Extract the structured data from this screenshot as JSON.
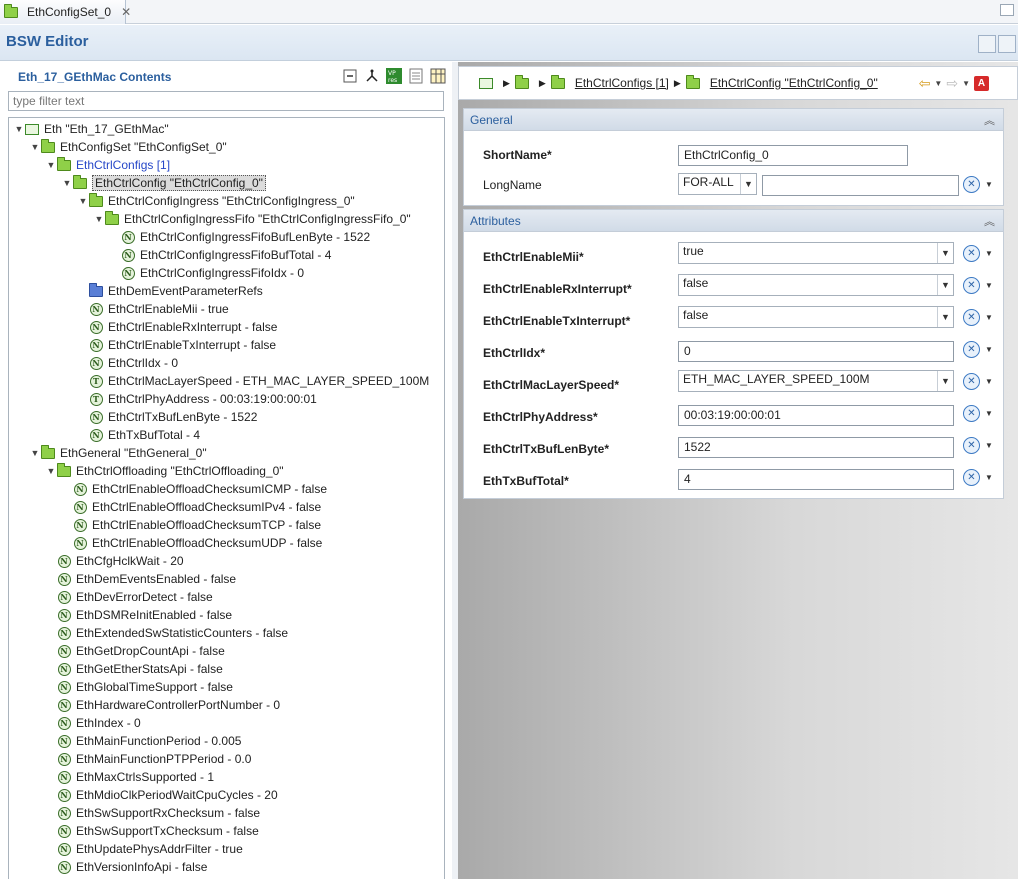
{
  "tab": {
    "label": "EthConfigSet_0",
    "close": "✕"
  },
  "editor": {
    "title": "BSW Editor"
  },
  "left": {
    "title": "Eth_17_GEthMac Contents",
    "filter_placeholder": "type filter text",
    "toolbar": [
      "collapse-all-icon",
      "hierarchy-icon",
      "vp-res-icon",
      "document-icon",
      "table-icon"
    ],
    "tree": [
      {
        "text": "Eth \"Eth_17_GEthMac\"",
        "icon": "module",
        "level": 0,
        "expanded": true
      },
      {
        "text": "EthConfigSet \"EthConfigSet_0\"",
        "icon": "folder",
        "level": 1,
        "expanded": true
      },
      {
        "text": "EthCtrlConfigs [1]",
        "icon": "folder",
        "level": 2,
        "expanded": true,
        "link": true
      },
      {
        "text": "EthCtrlConfig \"EthCtrlConfig_0\"",
        "icon": "folder",
        "level": 3,
        "expanded": true,
        "selected": true
      },
      {
        "text": "EthCtrlConfigIngress \"EthCtrlConfigIngress_0\"",
        "icon": "folder",
        "level": 4,
        "expanded": true
      },
      {
        "text": "EthCtrlConfigIngressFifo \"EthCtrlConfigIngressFifo_0\"",
        "icon": "folder",
        "level": 5,
        "expanded": true
      },
      {
        "text": "EthCtrlConfigIngressFifoBufLenByte - 1522",
        "icon": "N",
        "level": 6
      },
      {
        "text": "EthCtrlConfigIngressFifoBufTotal - 4",
        "icon": "N",
        "level": 6
      },
      {
        "text": "EthCtrlConfigIngressFifoIdx - 0",
        "icon": "N",
        "level": 6
      },
      {
        "text": "EthDemEventParameterRefs",
        "icon": "folder-blue",
        "level": 4
      },
      {
        "text": "EthCtrlEnableMii - true",
        "icon": "N",
        "level": 4
      },
      {
        "text": "EthCtrlEnableRxInterrupt - false",
        "icon": "N",
        "level": 4
      },
      {
        "text": "EthCtrlEnableTxInterrupt - false",
        "icon": "N",
        "level": 4
      },
      {
        "text": "EthCtrlIdx - 0",
        "icon": "N",
        "level": 4
      },
      {
        "text": "EthCtrlMacLayerSpeed - ETH_MAC_LAYER_SPEED_100M",
        "icon": "T",
        "level": 4
      },
      {
        "text": "EthCtrlPhyAddress - 00:03:19:00:00:01",
        "icon": "T",
        "level": 4
      },
      {
        "text": "EthCtrlTxBufLenByte - 1522",
        "icon": "N",
        "level": 4
      },
      {
        "text": "EthTxBufTotal - 4",
        "icon": "N",
        "level": 4
      },
      {
        "text": "EthGeneral \"EthGeneral_0\"",
        "icon": "folder",
        "level": 1,
        "expanded": true
      },
      {
        "text": "EthCtrlOffloading \"EthCtrlOffloading_0\"",
        "icon": "folder",
        "level": 2,
        "expanded": true
      },
      {
        "text": "EthCtrlEnableOffloadChecksumICMP - false",
        "icon": "N",
        "level": 3
      },
      {
        "text": "EthCtrlEnableOffloadChecksumIPv4 - false",
        "icon": "N",
        "level": 3
      },
      {
        "text": "EthCtrlEnableOffloadChecksumTCP - false",
        "icon": "N",
        "level": 3
      },
      {
        "text": "EthCtrlEnableOffloadChecksumUDP - false",
        "icon": "N",
        "level": 3
      },
      {
        "text": "EthCfgHclkWait - 20",
        "icon": "N",
        "level": 2
      },
      {
        "text": "EthDemEventsEnabled - false",
        "icon": "N",
        "level": 2
      },
      {
        "text": "EthDevErrorDetect - false",
        "icon": "N",
        "level": 2
      },
      {
        "text": "EthDSMReInitEnabled - false",
        "icon": "N",
        "level": 2
      },
      {
        "text": "EthExtendedSwStatisticCounters - false",
        "icon": "N",
        "level": 2
      },
      {
        "text": "EthGetDropCountApi - false",
        "icon": "N",
        "level": 2
      },
      {
        "text": "EthGetEtherStatsApi - false",
        "icon": "N",
        "level": 2
      },
      {
        "text": "EthGlobalTimeSupport - false",
        "icon": "N",
        "level": 2
      },
      {
        "text": "EthHardwareControllerPortNumber - 0",
        "icon": "N",
        "level": 2
      },
      {
        "text": "EthIndex - 0",
        "icon": "N",
        "level": 2
      },
      {
        "text": "EthMainFunctionPeriod - 0.005",
        "icon": "N",
        "level": 2
      },
      {
        "text": "EthMainFunctionPTPPeriod - 0.0",
        "icon": "N",
        "level": 2
      },
      {
        "text": "EthMaxCtrlsSupported - 1",
        "icon": "N",
        "level": 2
      },
      {
        "text": "EthMdioClkPeriodWaitCpuCycles - 20",
        "icon": "N",
        "level": 2
      },
      {
        "text": "EthSwSupportRxChecksum - false",
        "icon": "N",
        "level": 2
      },
      {
        "text": "EthSwSupportTxChecksum - false",
        "icon": "N",
        "level": 2
      },
      {
        "text": "EthUpdatePhysAddrFilter - true",
        "icon": "N",
        "level": 2
      },
      {
        "text": "EthVersionInfoApi - false",
        "icon": "N",
        "level": 2
      }
    ]
  },
  "right": {
    "breadcrumb": {
      "item1": "EthCtrlConfigs [1]",
      "item2": "EthCtrlConfig \"EthCtrlConfig_0\""
    },
    "general": {
      "title": "General",
      "shortname_label": "ShortName*",
      "shortname_value": "EthCtrlConfig_0",
      "longname_label": "LongName",
      "longname_lang": "FOR-ALL",
      "longname_value": ""
    },
    "attributes": {
      "title": "Attributes",
      "rows": [
        {
          "label": "EthCtrlEnableMii*",
          "value": "true",
          "kind": "combo"
        },
        {
          "label": "EthCtrlEnableRxInterrupt*",
          "value": "false",
          "kind": "combo"
        },
        {
          "label": "EthCtrlEnableTxInterrupt*",
          "value": "false",
          "kind": "combo"
        },
        {
          "label": "EthCtrlIdx*",
          "value": "0",
          "kind": "text"
        },
        {
          "label": "EthCtrlMacLayerSpeed*",
          "value": "ETH_MAC_LAYER_SPEED_100M",
          "kind": "combo"
        },
        {
          "label": "EthCtrlPhyAddress*",
          "value": "00:03:19:00:00:01",
          "kind": "text"
        },
        {
          "label": "EthCtrlTxBufLenByte*",
          "value": "1522",
          "kind": "text"
        },
        {
          "label": "EthTxBufTotal*",
          "value": "4",
          "kind": "text"
        }
      ]
    }
  },
  "colors": {
    "accent": "#2b5f9e",
    "link": "#2647c8",
    "folder": "#8fd048"
  }
}
